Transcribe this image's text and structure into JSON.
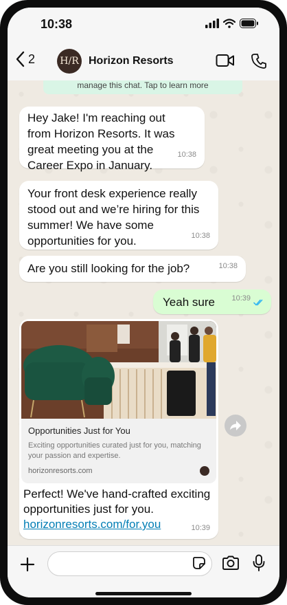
{
  "status_bar": {
    "time": "10:38"
  },
  "header": {
    "back_count": "2",
    "avatar_initials": "H/R",
    "contact_name": "Horizon Resorts"
  },
  "system_notice": "manage this chat. Tap to learn more",
  "messages": [
    {
      "text": "Hey Jake! I'm reaching out from Horizon Resorts. It was great meeting you at the Career Expo in January.",
      "time": "10:38"
    },
    {
      "text": "Your front desk experience really stood out and we’re hiring for this summer! We have some opportunities for you.",
      "time": "10:38"
    },
    {
      "text": "Are you still looking for the job?",
      "time": "10:38"
    },
    {
      "text": "Yeah sure",
      "time": "10:39"
    }
  ],
  "link_message": {
    "preview_title": "Opportunities Just for You",
    "preview_description": "Exciting opportunities curated just for you, matching your passion and expertise.",
    "preview_domain": "horizonresorts.com",
    "text": "Perfect! We've hand-crafted exciting opportunities just for you.",
    "link": "horizonresorts.com/for.you",
    "time": "10:39"
  },
  "input": {
    "value": ""
  },
  "colors": {
    "incoming_bubble": "#ffffff",
    "outgoing_bubble": "#d9fdd3",
    "chat_background": "#efeae2",
    "link": "#027eb5",
    "read_ticks": "#34b7f1"
  },
  "icons": [
    "back-chevron-icon",
    "video-call-icon",
    "phone-call-icon",
    "plus-icon",
    "sticker-icon",
    "camera-icon",
    "microphone-icon",
    "forward-icon",
    "double-check-icon"
  ]
}
